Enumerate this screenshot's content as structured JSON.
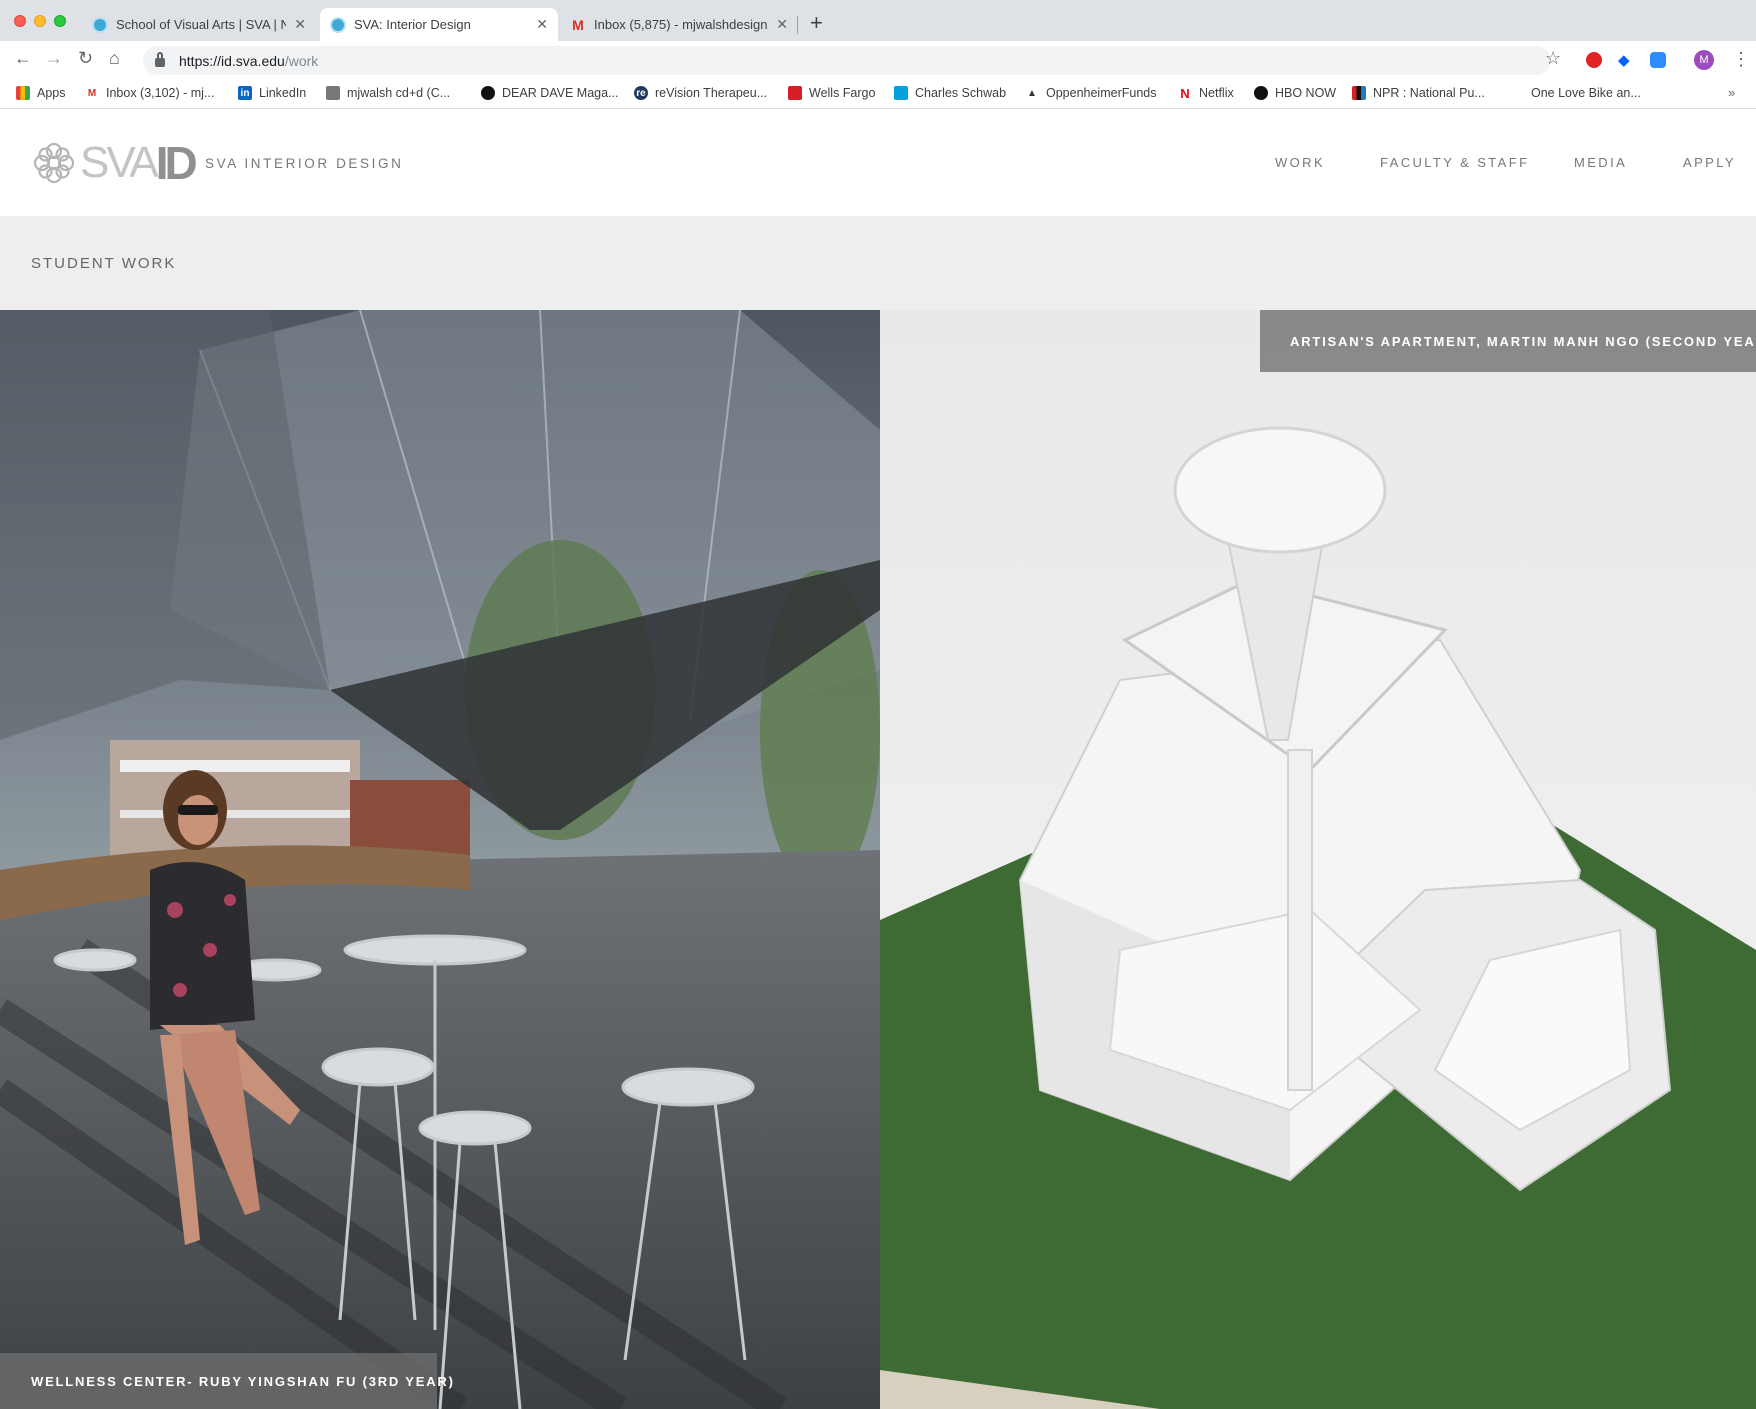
{
  "browser": {
    "tabs": [
      {
        "title": "School of Visual Arts | SVA | Ne",
        "favicon": "sva-icon"
      },
      {
        "title": "SVA: Interior Design",
        "favicon": "sva-icon"
      },
      {
        "title": "Inbox (5,875) - mjwalshdesign",
        "favicon": "gmail-icon"
      }
    ],
    "url_host": "https://id.sva.edu",
    "url_path": "/work",
    "profile_initial": "M",
    "bookmarks": [
      {
        "label": "Apps"
      },
      {
        "label": "Inbox (3,102) - mj..."
      },
      {
        "label": "LinkedIn"
      },
      {
        "label": "mjwalsh cd+d (C..."
      },
      {
        "label": "DEAR DAVE Maga..."
      },
      {
        "label": "reVision Therapeu..."
      },
      {
        "label": "Wells Fargo"
      },
      {
        "label": "Charles Schwab"
      },
      {
        "label": "OppenheimerFunds"
      },
      {
        "label": "Netflix"
      },
      {
        "label": "HBO NOW"
      },
      {
        "label": "NPR : National Pu..."
      },
      {
        "label": "One Love Bike an..."
      }
    ]
  },
  "site": {
    "logo_sva": "SVA",
    "logo_id": "ID",
    "name": "SVA INTERIOR DESIGN",
    "nav": [
      "WORK",
      "FACULTY & STAFF",
      "MEDIA",
      "APPLY"
    ]
  },
  "page": {
    "title": "STUDENT WORK"
  },
  "gallery": {
    "left_caption": "WELLNESS CENTER- RUBY YINGSHAN FU (3RD YEAR)",
    "right_caption": "ARTISAN'S APARTMENT, MARTIN MANH NGO (SECOND YEAR)"
  }
}
